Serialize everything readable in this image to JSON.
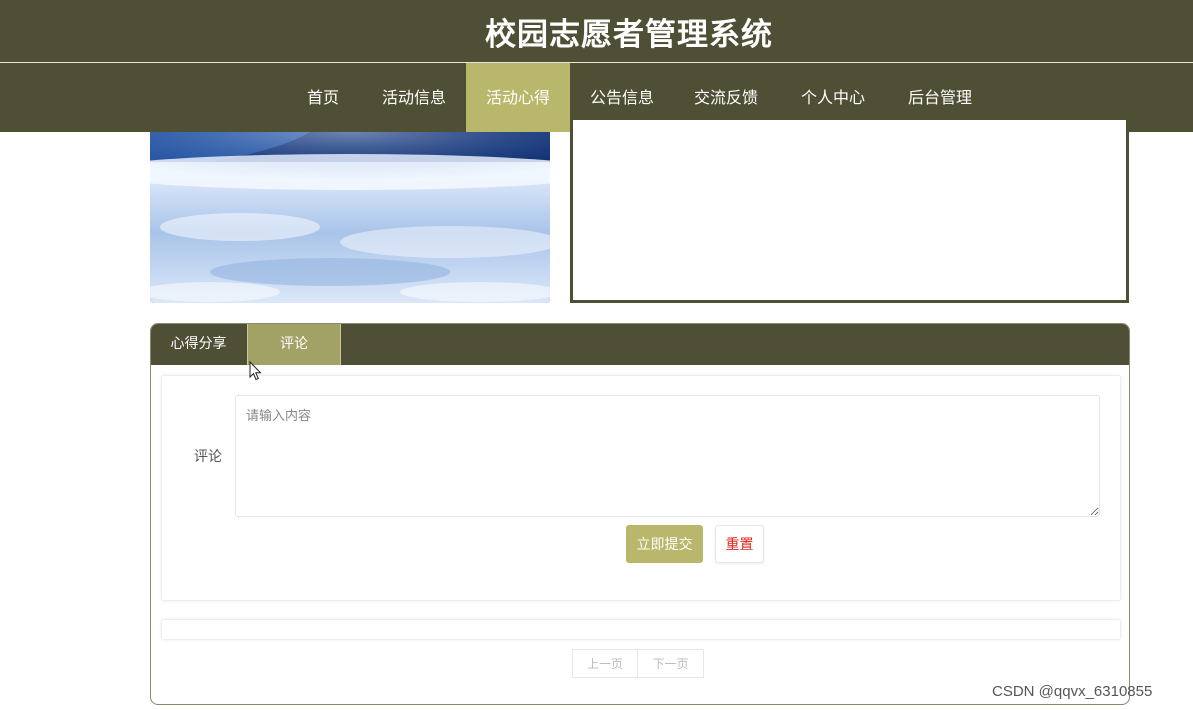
{
  "header": {
    "title": "校园志愿者管理系统"
  },
  "nav": {
    "items": [
      {
        "label": "首页"
      },
      {
        "label": "活动信息"
      },
      {
        "label": "活动心得"
      },
      {
        "label": "公告信息"
      },
      {
        "label": "交流反馈"
      },
      {
        "label": "个人中心"
      },
      {
        "label": "后台管理"
      }
    ],
    "active_index": 2
  },
  "tabs": {
    "items": [
      {
        "label": "心得分享"
      },
      {
        "label": "评论"
      }
    ],
    "active_index": 1
  },
  "comment_form": {
    "label": "评论",
    "placeholder": "请输入内容",
    "value": "",
    "submit_label": "立即提交",
    "reset_label": "重置"
  },
  "pager": {
    "prev_label": "上一页",
    "next_label": "下一页"
  },
  "watermark": "CSDN @qqvx_6310855",
  "colors": {
    "header_bg": "#4f4f35",
    "accent": "#b8b76b",
    "reset_text": "#e0261b"
  }
}
